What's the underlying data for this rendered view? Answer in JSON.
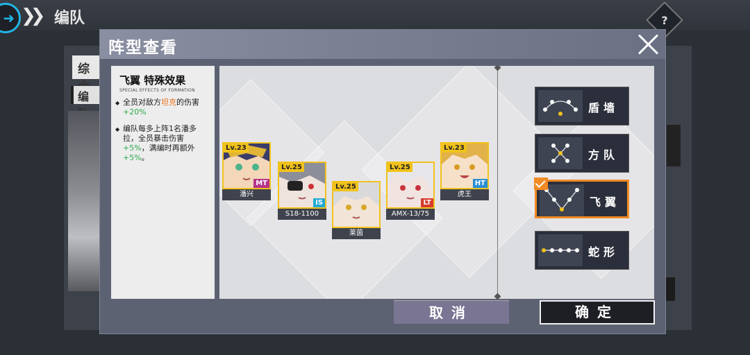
{
  "header": {
    "title": "编队",
    "help_icon": "?"
  },
  "background": {
    "tab_label": "综合",
    "tab2_label": "编队"
  },
  "dialog": {
    "title": "阵型查看",
    "effect": {
      "title": "飞翼 特殊效果",
      "subtitle": "SPECIAL EFFECTS OF FORMATION",
      "bullets": [
        {
          "pre": "全员对敌方",
          "highlight": "坦克",
          "mid": "的伤害",
          "value": "+20%",
          "post": ""
        },
        {
          "pre": "编队每多上阵1名潘多拉，全员暴击伤害",
          "value": "+5%",
          "mid": "，满编时再额外",
          "value2": "+5%",
          "post": "。"
        }
      ]
    },
    "units": [
      {
        "level": "Lv.23",
        "role": "MT",
        "name": "潘兴"
      },
      {
        "level": "Lv.25",
        "role": "IS",
        "name": "S18-1100"
      },
      {
        "level": "Lv.25",
        "role": "",
        "name": "莱茵"
      },
      {
        "level": "Lv.25",
        "role": "LT",
        "name": "AMX-13/75"
      },
      {
        "level": "Lv.23",
        "role": "HT",
        "name": "虎王"
      }
    ],
    "formations": [
      {
        "label": "盾墙",
        "icon": "arc-formation-icon",
        "selected": false
      },
      {
        "label": "方队",
        "icon": "square-formation-icon",
        "selected": false
      },
      {
        "label": "飞翼",
        "icon": "wing-formation-icon",
        "selected": true
      },
      {
        "label": "蛇形",
        "icon": "line-formation-icon",
        "selected": false
      }
    ],
    "buttons": {
      "cancel": "取消",
      "confirm": "确定"
    }
  },
  "colors": {
    "accent_orange": "#f08a24",
    "level_yellow": "#f1c21b",
    "role_MT": "#b5338a",
    "role_IS": "#23a9d8",
    "role_LT": "#d63a2c",
    "role_HT": "#2a8fd6"
  }
}
